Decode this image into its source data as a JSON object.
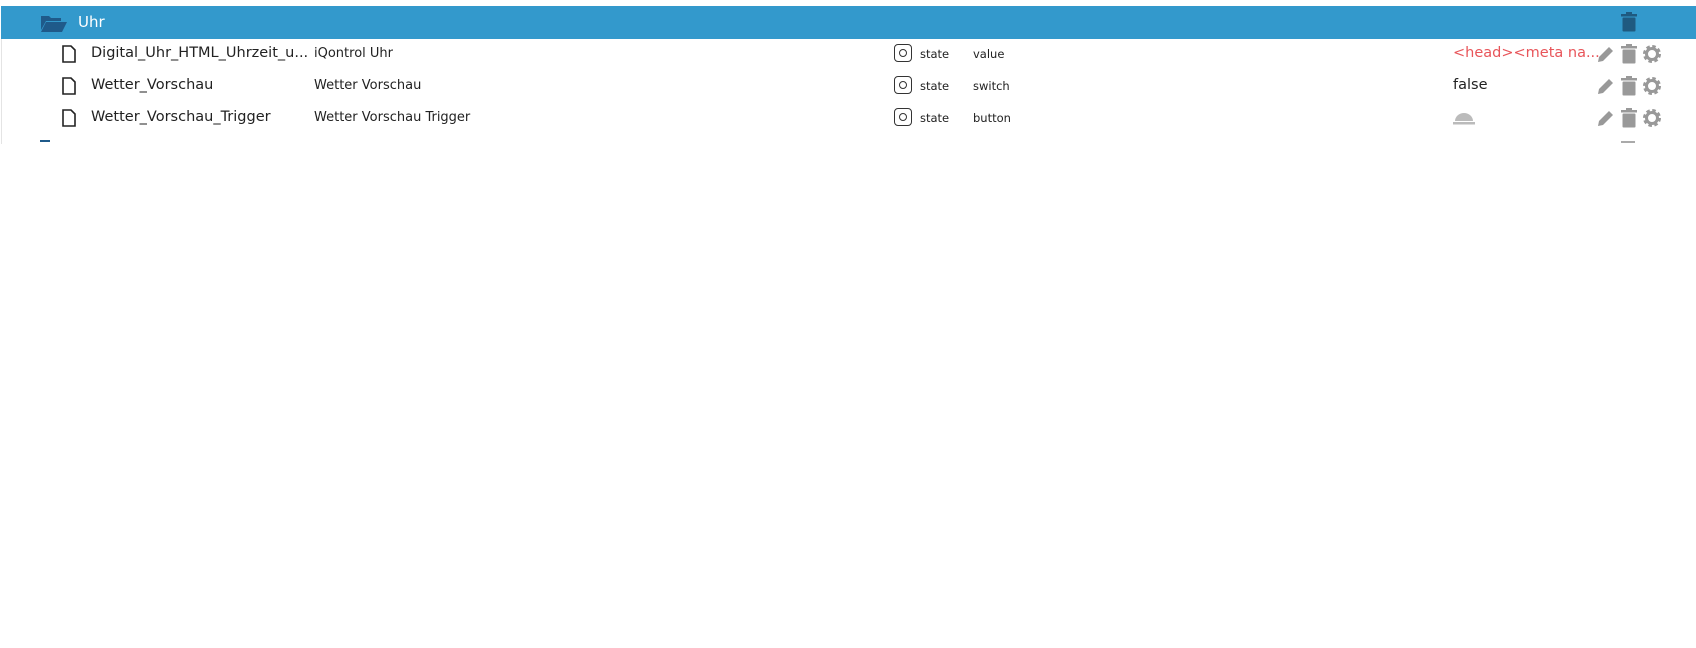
{
  "folder": {
    "label": "Uhr",
    "icon": "folder-open-icon",
    "color": "#3399cc"
  },
  "rows": [
    {
      "name": "Digital_Uhr_HTML_Uhrzeit_u...",
      "title": "iQontrol Uhr",
      "type": "state",
      "role": "value",
      "value": "<head><meta na...",
      "value_color": "#e8555a"
    },
    {
      "name": "Wetter_Vorschau",
      "title": "Wetter Vorschau",
      "type": "state",
      "role": "switch",
      "value": "false"
    },
    {
      "name": "Wetter_Vorschau_Trigger",
      "title": "Wetter Vorschau Trigger",
      "type": "state",
      "role": "button",
      "value_icon": "bell-icon"
    }
  ]
}
